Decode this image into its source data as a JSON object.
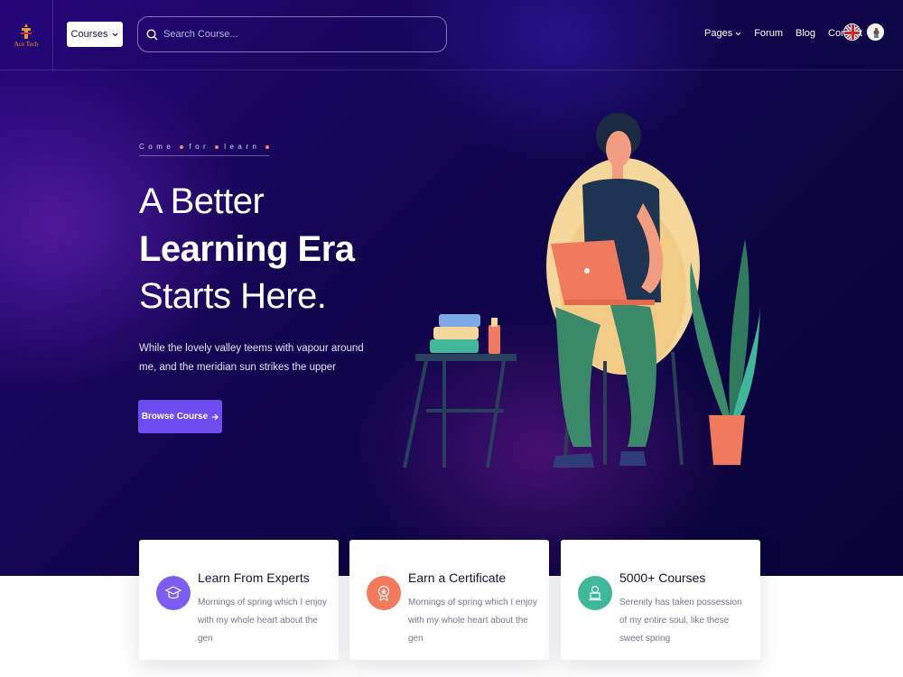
{
  "logo": {
    "text": "Ace Tech"
  },
  "header": {
    "courses_label": "Courses",
    "search_placeholder": "Search Course...",
    "nav": [
      "Pages",
      "Forum",
      "Blog",
      "Contact"
    ]
  },
  "hero": {
    "tagline": [
      "Come",
      "for",
      "learn"
    ],
    "line1": "A Better",
    "line2": "Learning Era",
    "line3": "Starts Here.",
    "description": "While the lovely valley teems with vapour around me, and the meridian sun strikes the upper",
    "button_label": "Browse Course"
  },
  "features": [
    {
      "title": "Learn From Experts",
      "text": "Mornings of spring which I enjoy with my whole heart about the gen",
      "color": "#7d5cf2",
      "icon": "graduation-cap-icon"
    },
    {
      "title": "Earn a Certificate",
      "text": "Mornings of spring which I enjoy with my whole heart about the gen",
      "color": "#f47a5e",
      "icon": "certificate-icon"
    },
    {
      "title": "5000+ Courses",
      "text": "Serenity has taken possession of my entire soul, like these sweet spring",
      "color": "#3fb89a",
      "icon": "laptop-user-icon"
    }
  ],
  "colors": {
    "accent": "#6d4cf0",
    "hero_bg": "#130551"
  }
}
